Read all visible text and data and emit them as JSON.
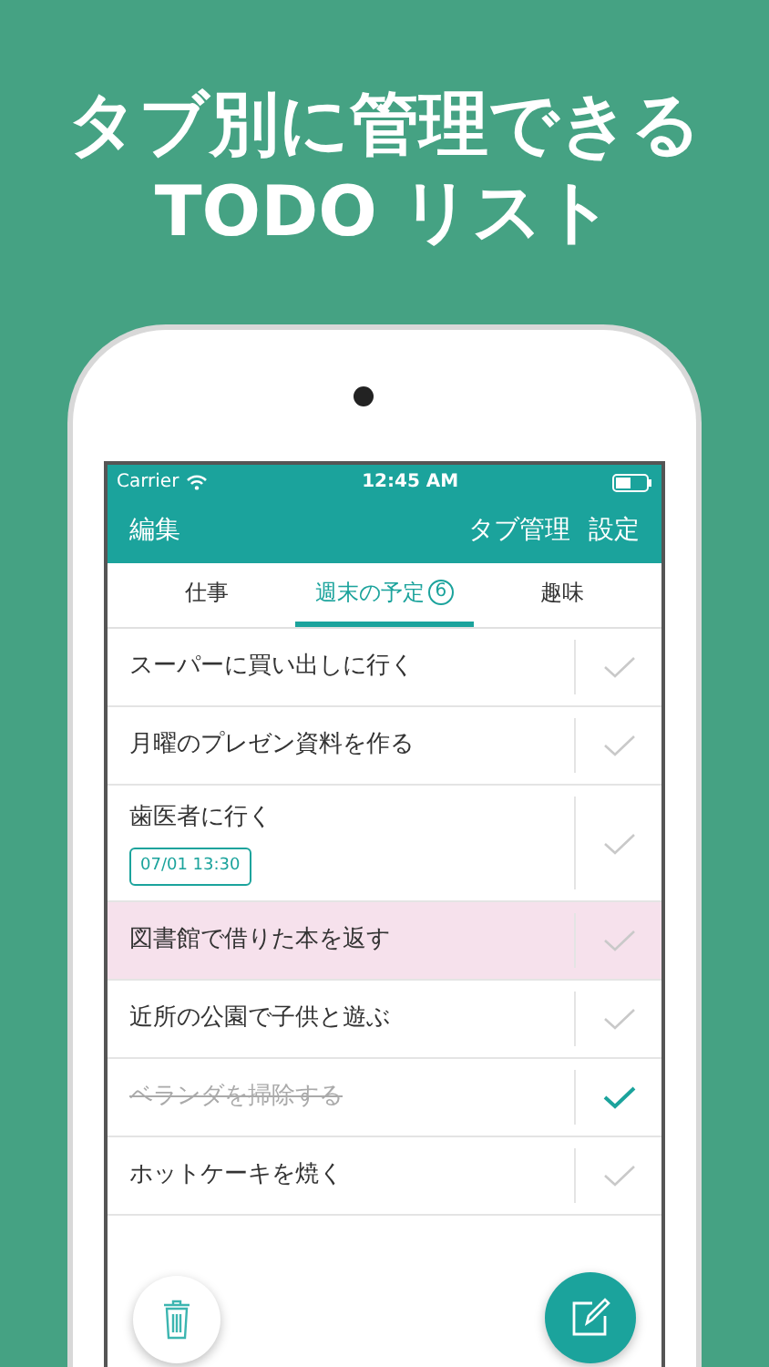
{
  "headline": [
    "タブ別に管理できる",
    "TODO リスト"
  ],
  "status_bar": {
    "carrier": "Carrier",
    "time": "12:45 AM"
  },
  "nav_bar": {
    "left": "編集",
    "right": [
      "タブ管理",
      "設定"
    ]
  },
  "tabs": [
    {
      "label": "仕事",
      "selected": false
    },
    {
      "label": "週末の予定",
      "badge": "6",
      "selected": true
    },
    {
      "label": "趣味",
      "selected": false
    }
  ],
  "todos": [
    {
      "title": "スーパーに買い出しに行く",
      "done": false,
      "highlighted": false
    },
    {
      "title": "月曜のプレゼン資料を作る",
      "done": false,
      "highlighted": false
    },
    {
      "title": "歯医者に行く",
      "date": "07/01 13:30",
      "done": false,
      "highlighted": false
    },
    {
      "title": "図書館で借りた本を返す",
      "done": false,
      "highlighted": true
    },
    {
      "title": "近所の公園で子供と遊ぶ",
      "done": false,
      "highlighted": false
    },
    {
      "title": "ベランダを掃除する",
      "done": true,
      "highlighted": false
    },
    {
      "title": "ホットケーキを焼く",
      "done": false,
      "highlighted": false
    }
  ]
}
